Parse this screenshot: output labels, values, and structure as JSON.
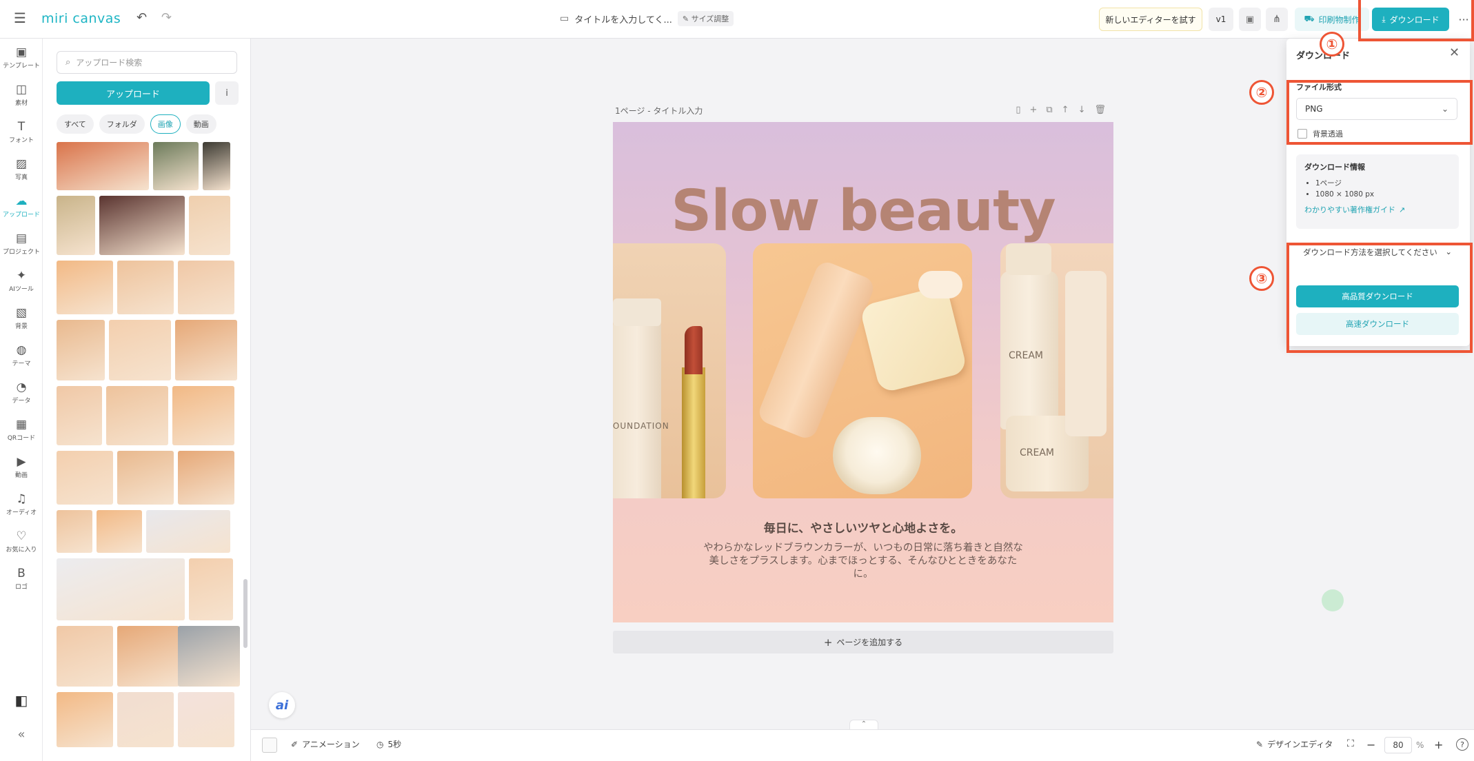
{
  "topbar": {
    "logo": "miri canvas",
    "doc_title": "タイトルを入力してく...",
    "size_badge": "サイズ調整",
    "try_new_editor": "新しいエディターを試す",
    "version": "v1",
    "print_label": "印刷物制作",
    "download_label": "ダウンロード",
    "more": "···"
  },
  "rail": [
    {
      "icon": "template-icon",
      "glyph": "▣",
      "label": "テンプレート"
    },
    {
      "icon": "elements-icon",
      "glyph": "◫",
      "label": "素材"
    },
    {
      "icon": "font-icon",
      "glyph": "T",
      "label": "フォント"
    },
    {
      "icon": "photo-icon",
      "glyph": "▨",
      "label": "写真"
    },
    {
      "icon": "upload-cloud-icon",
      "glyph": "☁",
      "label": "アップロード"
    },
    {
      "icon": "project-icon",
      "glyph": "▤",
      "label": "プロジェクト"
    },
    {
      "icon": "ai-tools-icon",
      "glyph": "✦",
      "label": "AIツール"
    },
    {
      "icon": "background-icon",
      "glyph": "▧",
      "label": "背景"
    },
    {
      "icon": "theme-icon",
      "glyph": "◍",
      "label": "テーマ"
    },
    {
      "icon": "data-icon",
      "glyph": "◔",
      "label": "データ"
    },
    {
      "icon": "qr-code-icon",
      "glyph": "▦",
      "label": "QRコード"
    },
    {
      "icon": "video-icon",
      "glyph": "▶",
      "label": "動画"
    },
    {
      "icon": "audio-icon",
      "glyph": "♫",
      "label": "オーディオ"
    },
    {
      "icon": "favorite-icon",
      "glyph": "♡",
      "label": "お気に入り"
    },
    {
      "icon": "logo-icon",
      "glyph": "B",
      "label": "ロゴ"
    }
  ],
  "panel": {
    "search_placeholder": "アップロード検索",
    "upload_label": "アップロード",
    "info": "i",
    "chips": [
      "すべて",
      "フォルダ",
      "画像",
      "動画"
    ]
  },
  "canvas": {
    "page_label": "1ページ - タイトル入力",
    "headline": "Slow beauty",
    "subhead": "毎日に、やさしいツヤと心地よさを。",
    "body": "やわらかなレッドブラウンカラーが、いつもの日常に落ち着きと自然な美しさをプラスします。心までほっとする、そんなひとときをあなたに。",
    "bottle_text_left": "FOUNDATION",
    "bottle_text_cream1": "CREAM",
    "bottle_text_cream2": "CREAM",
    "add_page": "ページを追加する",
    "ai_label": "ai"
  },
  "bottombar": {
    "animation": "アニメーション",
    "duration": "5秒",
    "design_editor": "デザインエディタ",
    "zoom": "80",
    "zoom_unit": "%"
  },
  "download_panel": {
    "title": "ダウンロード",
    "file_format_label": "ファイル形式",
    "file_format_value": "PNG",
    "transparent_bg": "背景透過",
    "info_title": "ダウンロード情報",
    "info_items": [
      "1ページ",
      "1080 × 1080 px"
    ],
    "guide_link": "わかりやすい著作権ガイド",
    "method_label": "ダウンロード方法を選択してください",
    "hq_download": "高品質ダウンロード",
    "fast_download": "高速ダウンロード"
  },
  "annotations": [
    "①",
    "②",
    "③"
  ],
  "colors": {
    "accent": "#1eb0bf",
    "annotation": "#ee5535"
  }
}
